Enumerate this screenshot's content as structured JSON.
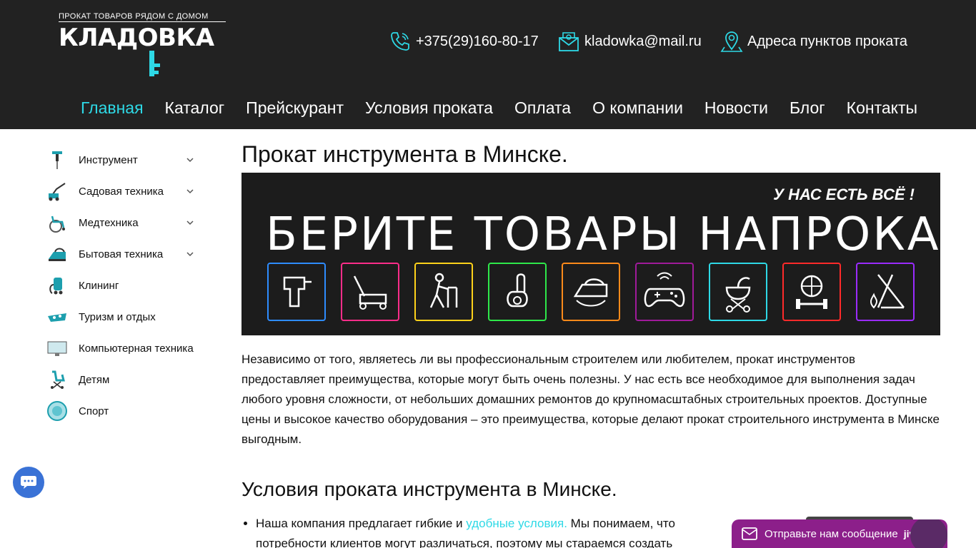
{
  "header": {
    "logo_tagline": "ПРОКАТ ТОВАРОВ РЯДОМ С ДОМОМ",
    "logo_text": "КЛАДОВКА",
    "phone": "+375(29)160-80-17",
    "email": "kladowka@mail.ru",
    "addresses": "Адреса пунктов проката"
  },
  "nav": [
    {
      "label": "Главная",
      "active": true
    },
    {
      "label": "Каталог"
    },
    {
      "label": "Прейскурант"
    },
    {
      "label": "Условия проката"
    },
    {
      "label": "Оплата"
    },
    {
      "label": "О компании"
    },
    {
      "label": "Новости"
    },
    {
      "label": "Блог"
    },
    {
      "label": "Контакты"
    }
  ],
  "sidebar": [
    {
      "label": "Инструмент",
      "has_children": true
    },
    {
      "label": "Садовая техника",
      "has_children": true
    },
    {
      "label": "Медтехника",
      "has_children": true
    },
    {
      "label": "Бытовая техника",
      "has_children": true
    },
    {
      "label": "Клининг",
      "has_children": false
    },
    {
      "label": "Туризм и отдых",
      "has_children": false
    },
    {
      "label": "Компьютерная техника",
      "has_children": false
    },
    {
      "label": "Детям",
      "has_children": false
    },
    {
      "label": "Спорт",
      "has_children": false
    }
  ],
  "main": {
    "title": "Прокат инструмента в Минске.",
    "banner_small": "У НАС ЕСТЬ ВСЁ !",
    "banner_big": "БЕРИТЕ ТОВАРЫ НАПРОКАТ",
    "banner_icons": [
      "drill-icon",
      "lawnmower-icon",
      "walker-icon",
      "vacuum-icon",
      "iron-icon",
      "gamepad-icon",
      "stroller-icon",
      "fitness-icon",
      "camping-icon"
    ],
    "banner_colors": [
      "#2e8cff",
      "#ff2d8a",
      "#ffd21a",
      "#2ee84a",
      "#ff8a1a",
      "#a01a9a",
      "#2ed9e6",
      "#ff2a2a",
      "#9a2bff"
    ],
    "intro": "Независимо от того, являетесь ли вы профессиональным строителем или любителем, прокат инструментов предоставляет преимущества, которые могут быть очень полезны. У нас есть все необходимое для выполнения задач любого уровня сложности, от небольших домашних ремонтов до крупномасштабных строительных проектов. Доступные цены и высокое качество оборудования – это преимущества, которые делают прокат строительного инструмента в Минске выгодным.",
    "subtitle": "Условия проката инструмента в Минске.",
    "bullet_prefix": "Наша компания предлагает гибкие и ",
    "bullet_link": "удобные условия.",
    "bullet_suffix": " Мы понимаем, что потребности клиентов могут различаться, поэтому мы стараемся создать"
  },
  "widgets": {
    "jivo_label": "Отправьте нам сообщение",
    "jivo_brand": "jivo"
  },
  "colors": {
    "accent": "#2ed9e6",
    "header_bg": "#222222",
    "logo_yellow": "#f2e51c"
  }
}
